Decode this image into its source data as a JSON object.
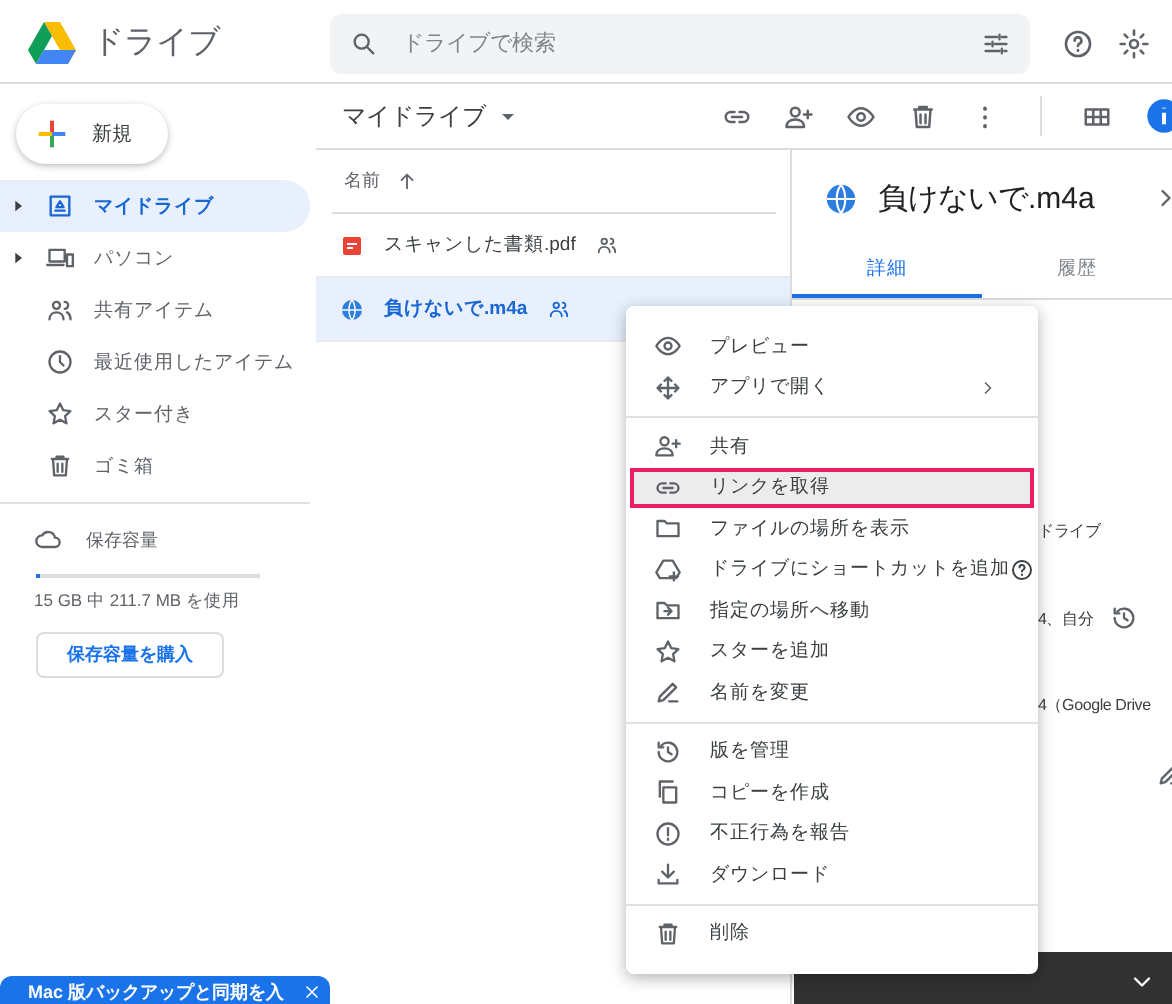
{
  "header": {
    "app_name": "ドライブ",
    "search": {
      "placeholder": "ドライブで検索"
    }
  },
  "sidebar": {
    "new_button": "新規",
    "items": [
      {
        "label": "マイドライブ",
        "selected": true,
        "expandable": true
      },
      {
        "label": "パソコン",
        "selected": false,
        "expandable": true
      },
      {
        "label": "共有アイテム",
        "selected": false,
        "expandable": false
      },
      {
        "label": "最近使用したアイテム",
        "selected": false,
        "expandable": false
      },
      {
        "label": "スター付き",
        "selected": false,
        "expandable": false
      },
      {
        "label": "ゴミ箱",
        "selected": false,
        "expandable": false
      }
    ],
    "storage": {
      "label": "保存容量",
      "level": 0.014,
      "usage": "15 GB 中 211.7 MB を使用",
      "buy_button": "保存容量を購入"
    }
  },
  "toolbar": {
    "title": "マイドライブ"
  },
  "file_list": {
    "column": "名前",
    "rows": [
      {
        "name": "スキャンした書類.pdf",
        "kind": "pdf",
        "shared": true,
        "selected": false
      },
      {
        "name": "負けないで.m4a",
        "kind": "audio",
        "shared": true,
        "selected": true
      }
    ]
  },
  "details": {
    "title": "負けないで.m4a",
    "tabs": [
      {
        "label": "詳細",
        "selected": true
      },
      {
        "label": "履歴",
        "selected": false
      }
    ],
    "fields": [
      "ドライブ",
      "4、自分",
      "4（Google Drive"
    ]
  },
  "context_menu": {
    "groups": [
      [
        {
          "label": "プレビュー",
          "submenu": false,
          "help": false,
          "highlighted": false
        },
        {
          "label": "アプリで開く",
          "submenu": true,
          "help": false,
          "highlighted": false
        }
      ],
      [
        {
          "label": "共有",
          "submenu": false,
          "help": false,
          "highlighted": false
        },
        {
          "label": "リンクを取得",
          "submenu": false,
          "help": false,
          "highlighted": true
        },
        {
          "label": "ファイルの場所を表示",
          "submenu": false,
          "help": false,
          "highlighted": false
        },
        {
          "label": "ドライブにショートカットを追加",
          "submenu": false,
          "help": true,
          "highlighted": false
        },
        {
          "label": "指定の場所へ移動",
          "submenu": false,
          "help": false,
          "highlighted": false
        },
        {
          "label": "スターを追加",
          "submenu": false,
          "help": false,
          "highlighted": false
        },
        {
          "label": "名前を変更",
          "submenu": false,
          "help": false,
          "highlighted": false
        }
      ],
      [
        {
          "label": "版を管理",
          "submenu": false,
          "help": false,
          "highlighted": false
        },
        {
          "label": "コピーを作成",
          "submenu": false,
          "help": false,
          "highlighted": false
        },
        {
          "label": "不正行為を報告",
          "submenu": false,
          "help": false,
          "highlighted": false
        },
        {
          "label": "ダウンロード",
          "submenu": false,
          "help": false,
          "highlighted": false
        }
      ],
      [
        {
          "label": "削除",
          "submenu": false,
          "help": false,
          "highlighted": false
        }
      ]
    ]
  },
  "banner": {
    "text": "Mac 版バックアップと同期を入"
  }
}
